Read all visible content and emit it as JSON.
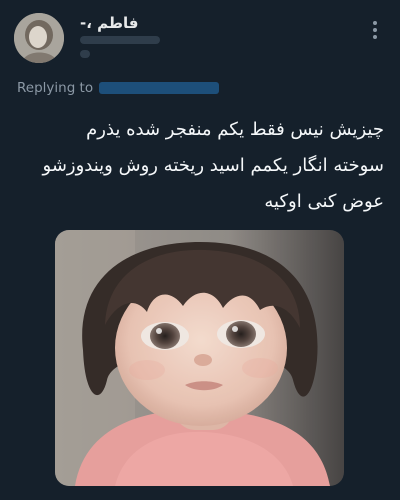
{
  "tweet": {
    "author": {
      "display_name": "فاطم ،-",
      "avatar_icon": "avatar-photo"
    },
    "more_icon": "more-vertical-icon",
    "replying_to_label": "Replying to",
    "text_lines": [
      "چیزیش نیس فقط یکم منفجر شده یذرم",
      "سوخته انگار یکمم اسید ریخته روش ویندوزشو",
      "عوض کنی اوکیه"
    ],
    "media": {
      "type": "photo"
    }
  },
  "colors": {
    "background": "#15202b",
    "text": "#ffffff",
    "secondary_text": "#8b98a5",
    "link": "#1d9bf0"
  }
}
